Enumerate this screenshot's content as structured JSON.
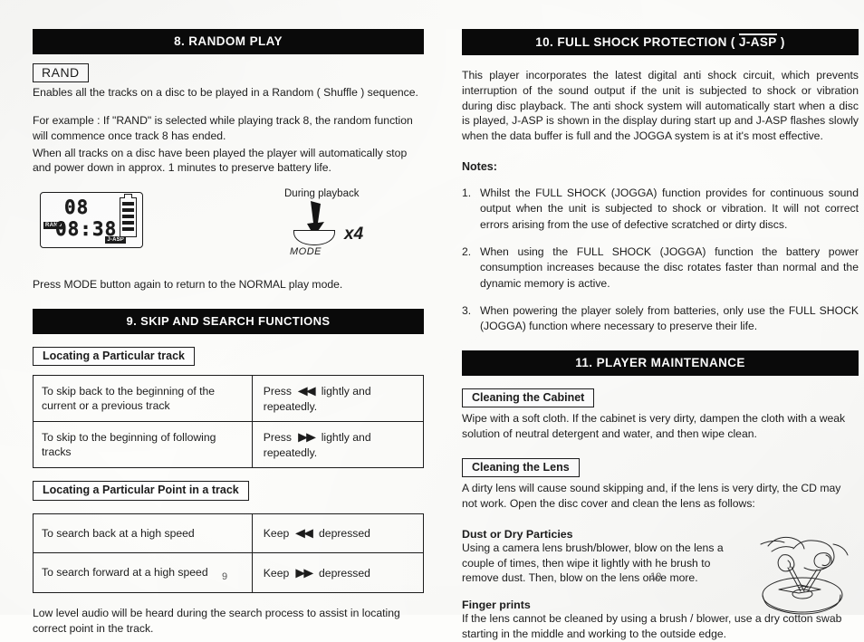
{
  "document": {
    "type": "cd-player-instruction-manual-spread",
    "page_numbers": {
      "left": "9",
      "right": "10"
    }
  },
  "left_column": {
    "section_8": {
      "banner": "8. RANDOM  PLAY",
      "rand_badge": "RAND",
      "intro": "Enables all the tracks on a disc to be played in a Random ( Shuffle ) sequence.",
      "example": "For example : If \"RAND\" is selected while playing track 8, the random function will commence once track 8 has ended.",
      "auto_stop": "When all tracks on a disc have been played the player will automatically stop and power down in approx. 1 minutes to preserve battery life.",
      "lcd_display": {
        "track_number": "08",
        "time": "08:38",
        "random_indicator": "RAND",
        "shock_indicator": "J-ASP",
        "battery_bars": 5
      },
      "mode_diagram": {
        "caption": "During playback",
        "button_label": "MODE",
        "press_count": "x4",
        "arrow_icon": "down-arrow-icon"
      },
      "closing": "Press MODE button again to return to the NORMAL play mode."
    },
    "section_9": {
      "banner": "9. SKIP AND SEARCH FUNCTIONS",
      "subhead_track": "Locating a Particular track",
      "table_track": [
        {
          "action": "To skip back to the beginning of the current or a previous track",
          "instruction_prefix": "Press",
          "glyph": "skip-back-icon",
          "glyph_char": "◀◀",
          "instruction_suffix": "lightly and repeatedly."
        },
        {
          "action": "To skip to the beginning of following tracks",
          "instruction_prefix": "Press",
          "glyph": "skip-forward-icon",
          "glyph_char": "▶▶",
          "instruction_suffix": "lightly and repeatedly."
        }
      ],
      "subhead_point": "Locating a Particular Point in a track",
      "table_point": [
        {
          "action": "To search back at a high speed",
          "instruction_prefix": "Keep",
          "glyph": "search-back-icon",
          "glyph_char": "◀◀",
          "instruction_suffix": "depressed"
        },
        {
          "action": "To search forward at a high speed",
          "instruction_prefix": "Keep",
          "glyph": "search-forward-icon",
          "glyph_char": "▶▶",
          "instruction_suffix": "depressed"
        }
      ],
      "footnote": "Low level audio will be heard during the search process to assist in locating correct point in the track."
    }
  },
  "right_column": {
    "section_10": {
      "banner_prefix": "10. FULL SHOCK PROTECTION ( ",
      "banner_mark": "J-ASP",
      "banner_suffix": " )",
      "paragraph": "This   player incorporates the latest   digital anti   shock circuit, which prevents interruption of the sound output if the unit  is subjected to shock  or  vibration  during disc playback. The anti shock system will automatically start when a disc is  played, J-ASP is shown in the display during start up and J-ASP  flashes slowly when  the data buffer is full and the JOGGA  system is at it's most effective.",
      "notes_label": "Notes:",
      "notes": [
        {
          "num": "1.",
          "text": "Whilst  the  FULL  SHOCK  (JOGGA) function   provides  for continuous  sound output when  the  unit  is  subjected  to shock or vibration. It will not correct errors   arising from the use of defective scratched or dirty discs."
        },
        {
          "num": "2.",
          "text": "When  using  the  FULL SHOCK  (JOGGA) function  the   battery  power consumption  increases  because  the  disc  rotates  faster  than  normal and  the dynamic  memory is active."
        },
        {
          "num": "3.",
          "text": "When  powering  the  player  solely from  batteries, only  use  the  FULL SHOCK (JOGGA)   function where necessary to preserve their life."
        }
      ]
    },
    "section_11": {
      "banner": "11. PLAYER MAINTENANCE",
      "cabinet": {
        "subhead": "Cleaning the Cabinet",
        "text": "Wipe with a soft cloth. If the cabinet is very dirty, dampen the cloth with a weak solution  of neutral detergent and water, and then wipe clean."
      },
      "lens": {
        "subhead": "Cleaning the Lens",
        "text": "A dirty lens will cause sound skipping and, if  the lens is very dirty, the  CD may not work.  Open the disc cover and clean the lens as follows:",
        "dust_title": "Dust or Dry Particies",
        "dust_text": "Using a camera lens brush/blower, blow on the lens a couple of times, then wipe it lightly with he brush to remove dust. Then, blow on the lens once more.",
        "finger_title": "Finger prints",
        "finger_text": "If the lens cannot be cleaned by using a brush / blower, use a dry cotton swab starting in the middle and working to the outside edge.",
        "illustration": "hands-cleaning-disc-illustration"
      }
    }
  }
}
